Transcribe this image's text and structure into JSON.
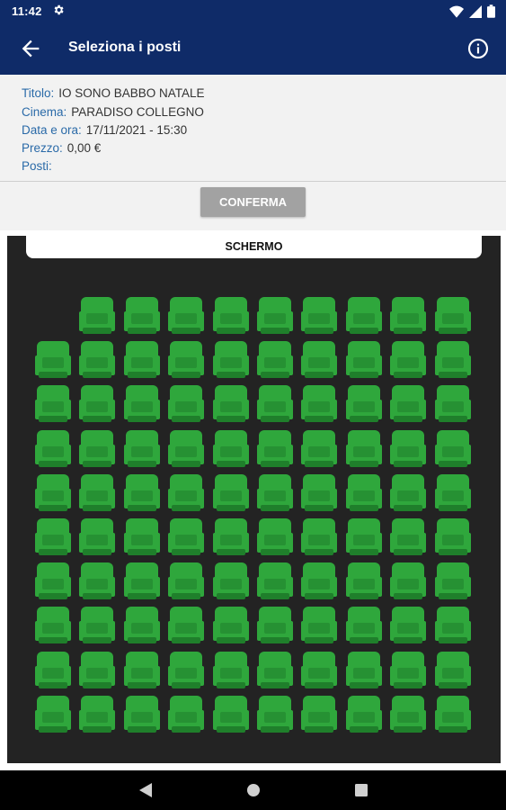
{
  "status_bar": {
    "time": "11:42"
  },
  "app_bar": {
    "title": "Seleziona i posti"
  },
  "info": {
    "title_label": "Titolo:",
    "title_value": "IO SONO BABBO NATALE",
    "cinema_label": "Cinema:",
    "cinema_value": "PARADISO COLLEGNO",
    "datetime_label": "Data e ora:",
    "datetime_value": "17/11/2021 - 15:30",
    "price_label": "Prezzo:",
    "price_value": "0,00 €",
    "seats_label": "Posti:",
    "seats_value": ""
  },
  "confirm_label": "CONFERMA",
  "seatmap": {
    "screen_label": "SCHERMO",
    "rows": 10,
    "columns": 10,
    "row_seat_columns": [
      [
        2,
        3,
        4,
        5,
        6,
        7,
        8,
        9,
        10
      ],
      [
        1,
        2,
        3,
        4,
        5,
        6,
        7,
        8,
        9,
        10
      ],
      [
        1,
        2,
        3,
        4,
        5,
        6,
        7,
        8,
        9,
        10
      ],
      [
        1,
        2,
        3,
        4,
        5,
        6,
        7,
        8,
        9,
        10
      ],
      [
        1,
        2,
        3,
        4,
        5,
        6,
        7,
        8,
        9,
        10
      ],
      [
        1,
        2,
        3,
        4,
        5,
        6,
        7,
        8,
        9,
        10
      ],
      [
        1,
        2,
        3,
        4,
        5,
        6,
        7,
        8,
        9,
        10
      ],
      [
        1,
        2,
        3,
        4,
        5,
        6,
        7,
        8,
        9,
        10
      ],
      [
        1,
        2,
        3,
        4,
        5,
        6,
        7,
        8,
        9,
        10
      ],
      [
        1,
        2,
        3,
        4,
        5,
        6,
        7,
        8,
        9,
        10
      ]
    ],
    "seat_status": "available",
    "colors": {
      "available": "#2fa73c",
      "available_dark": "#1f7f2b",
      "background": "#232323"
    }
  },
  "colors": {
    "primary": "#0f2b68",
    "label": "#2a6aa8",
    "button_disabled": "#a2a2a2"
  }
}
